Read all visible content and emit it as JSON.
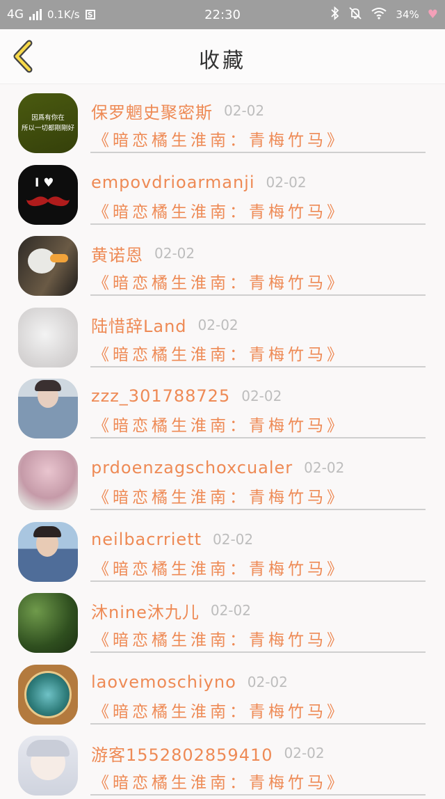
{
  "status": {
    "network": "4G",
    "speed": "0.1K/s",
    "s_label": "S",
    "time": "22:30",
    "battery": "34%"
  },
  "nav": {
    "title": "收藏"
  },
  "items": [
    {
      "name": "保罗魍史聚密斯",
      "date": "02-02",
      "title": "《暗恋橘生淮南：青梅竹马》",
      "avatar_text": "因爲有你在\n所以一切都剛剛好"
    },
    {
      "name": "empovdrioarmanji",
      "date": "02-02",
      "title": "《暗恋橘生淮南：青梅竹马》",
      "avatar_text": "I ♥"
    },
    {
      "name": "黄诺恩",
      "date": "02-02",
      "title": "《暗恋橘生淮南：青梅竹马》"
    },
    {
      "name": "陆惜辞Land",
      "date": "02-02",
      "title": "《暗恋橘生淮南：青梅竹马》"
    },
    {
      "name": "zzz_301788725",
      "date": "02-02",
      "title": "《暗恋橘生淮南：青梅竹马》"
    },
    {
      "name": "prdoenzagschoxcualer",
      "date": "02-02",
      "title": "《暗恋橘生淮南：青梅竹马》"
    },
    {
      "name": "neilbacrriett",
      "date": "02-02",
      "title": "《暗恋橘生淮南：青梅竹马》"
    },
    {
      "name": "沐nine沐九儿",
      "date": "02-02",
      "title": "《暗恋橘生淮南：青梅竹马》"
    },
    {
      "name": "laovemoschiyno",
      "date": "02-02",
      "title": "《暗恋橘生淮南：青梅竹马》"
    },
    {
      "name": "游客1552802859410",
      "date": "02-02",
      "title": "《暗恋橘生淮南：青梅竹马》"
    }
  ]
}
